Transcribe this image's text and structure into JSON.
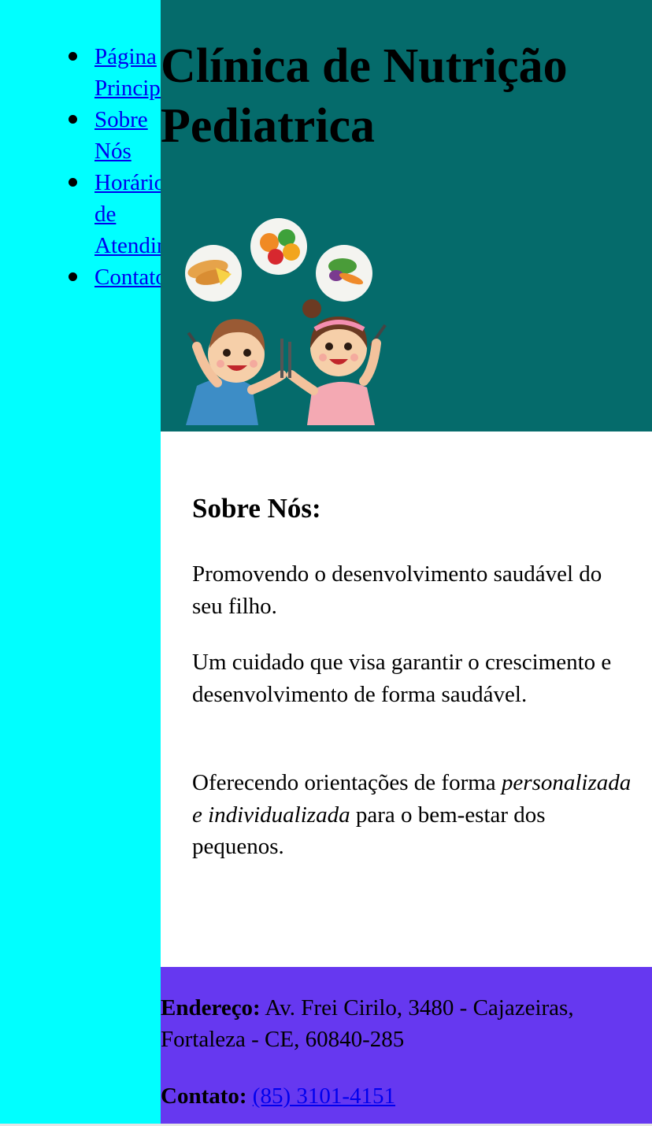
{
  "nav": {
    "items": [
      {
        "label": "Página Principal"
      },
      {
        "label": "Sobre Nós"
      },
      {
        "label": "Horários de Atendimento"
      },
      {
        "label": "Contato"
      }
    ]
  },
  "header": {
    "title": "Clínica de Nutrição Pediatrica",
    "illustration_icon": "kids-eating-healthy-illustration"
  },
  "about": {
    "heading": "Sobre Nós:",
    "p1": "Promovendo o desenvolvimento saudável do seu filho.",
    "p2": "Um cuidado que visa garantir o crescimento e desenvolvimento de forma saudável.",
    "p3_before": "Oferecendo orientações de forma ",
    "p3_emphasis": "personalizada e individualizada",
    "p3_after": " para o bem-estar dos pequenos."
  },
  "footer": {
    "address_label": "Endereço:",
    "address_value": " Av. Frei Cirilo, 3480 - Cajazeiras, Fortaleza - CE, 60840-285",
    "contact_label": "Contato:",
    "contact_phone": "(85) 3101-4151"
  },
  "colors": {
    "sidebar_bg": "#00ffff",
    "header_bg": "#056b6b",
    "footer_bg": "#6638f0",
    "link": "#0000ee"
  }
}
